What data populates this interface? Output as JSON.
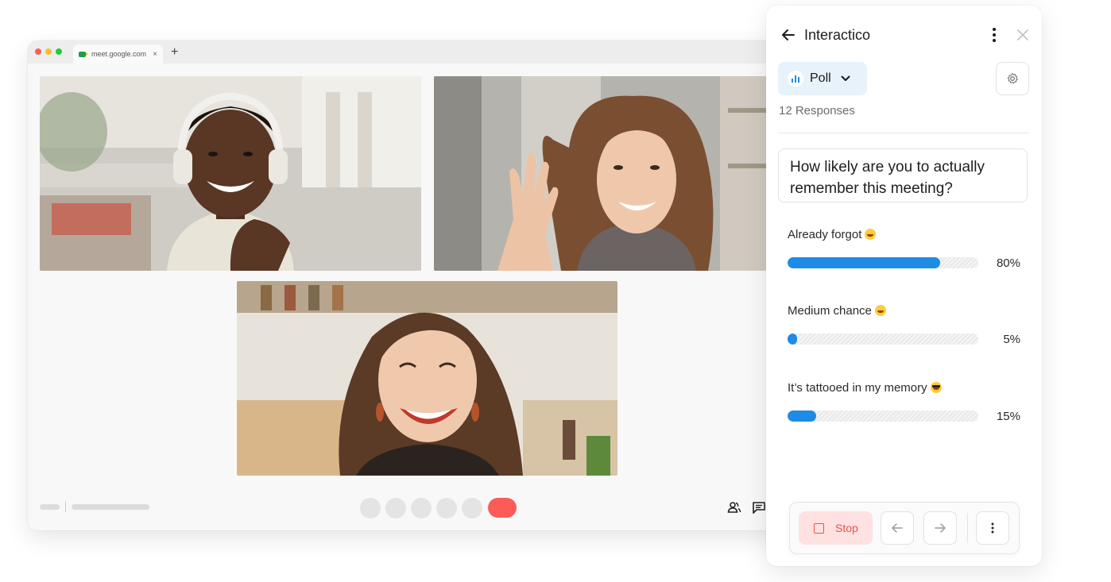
{
  "browser": {
    "tab_title": "meet.google.com",
    "tab_close": "×",
    "new_tab": "+"
  },
  "panel": {
    "app_title": "Interactico",
    "mode_label": "Poll",
    "responses_text": "12 Responses",
    "question": "How likely are you to actually remember this meeting?",
    "options": [
      {
        "label": "Already forgot",
        "emoji": "laughing-emoji",
        "percent_text": "80%",
        "fraction": 0.8
      },
      {
        "label": "Medium chance",
        "emoji": "smiling-emoji",
        "percent_text": "5%",
        "fraction": 0.05
      },
      {
        "label": "It’s tattooed in my memory",
        "emoji": "sunglasses-emoji",
        "percent_text": "15%",
        "fraction": 0.15
      }
    ],
    "stop_label": "Stop"
  },
  "colors": {
    "accent": "#1e8be6",
    "end_call": "#fd5b57",
    "stop_bg": "#ffe1e1",
    "mode_bg": "#e7f2fb"
  }
}
